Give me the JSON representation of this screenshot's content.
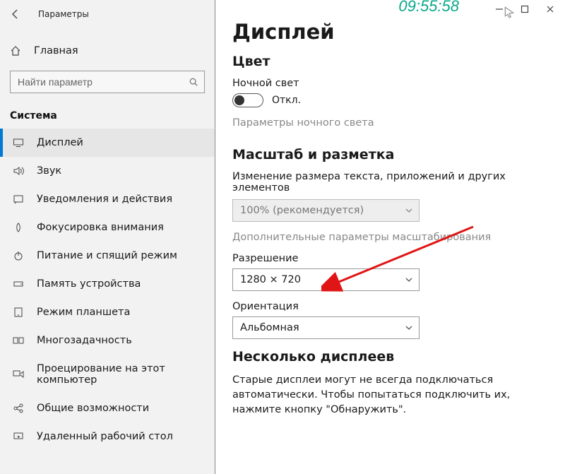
{
  "header": {
    "app_title": "Параметры",
    "clock": "09:55:58"
  },
  "sidebar": {
    "home": "Главная",
    "search_placeholder": "Найти параметр",
    "category": "Система",
    "items": [
      {
        "id": "display",
        "label": "Дисплей"
      },
      {
        "id": "sound",
        "label": "Звук"
      },
      {
        "id": "notify",
        "label": "Уведомления и действия"
      },
      {
        "id": "focus",
        "label": "Фокусировка внимания"
      },
      {
        "id": "power",
        "label": "Питание и спящий режим"
      },
      {
        "id": "storage",
        "label": "Память устройства"
      },
      {
        "id": "tablet",
        "label": "Режим планшета"
      },
      {
        "id": "multitask",
        "label": "Многозадачность"
      },
      {
        "id": "project",
        "label": "Проецирование на этот компьютер"
      },
      {
        "id": "shared",
        "label": "Общие возможности"
      },
      {
        "id": "remote",
        "label": "Удаленный рабочий стол"
      }
    ]
  },
  "main": {
    "page_title": "Дисплей",
    "color_section": "Цвет",
    "night_light_label": "Ночной свет",
    "toggle_state": "Откл.",
    "night_light_settings": "Параметры ночного света",
    "scale_section": "Масштаб и разметка",
    "scale_desc": "Изменение размера текста, приложений и других элементов",
    "scale_value": "100% (рекомендуется)",
    "advanced_scale": "Дополнительные параметры масштабирования",
    "resolution_label": "Разрешение",
    "resolution_value": "1280 × 720",
    "orientation_label": "Ориентация",
    "orientation_value": "Альбомная",
    "multi_section": "Несколько дисплеев",
    "multi_desc": "Старые дисплеи могут не всегда подключаться автоматически. Чтобы попытаться подключить их, нажмите кнопку \"Обнаружить\"."
  }
}
